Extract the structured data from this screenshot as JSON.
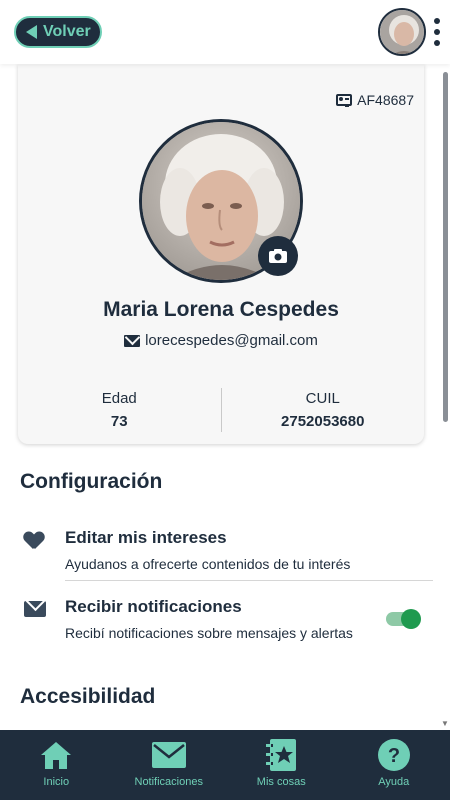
{
  "header": {
    "back_label": "Volver"
  },
  "profile": {
    "id_code": "AF48687",
    "name": "Maria Lorena Cespedes",
    "email": "lorecespedes@gmail.com",
    "stats": [
      {
        "label": "Edad",
        "value": "73"
      },
      {
        "label": "CUIL",
        "value": "2752053680"
      }
    ]
  },
  "config": {
    "title": "Configuración",
    "items": [
      {
        "title": "Editar mis intereses",
        "subtitle": "Ayudanos a ofrecerte contenidos de tu interés",
        "icon": "heart-icon"
      },
      {
        "title": "Recibir notificaciones",
        "subtitle": "Recibí notificaciones sobre mensajes y alertas",
        "icon": "envelope-icon",
        "toggle_on": true
      }
    ]
  },
  "accessibility": {
    "title": "Accesibilidad"
  },
  "bottom_nav": {
    "items": [
      {
        "label": "Inicio",
        "icon": "home-icon"
      },
      {
        "label": "Notificaciones",
        "icon": "mail-icon"
      },
      {
        "label": "Mis cosas",
        "icon": "star-notebook-icon"
      },
      {
        "label": "Ayuda",
        "icon": "help-icon"
      }
    ]
  },
  "colors": {
    "primary": "#1f2d3d",
    "accent": "#6fcfb6",
    "toggle": "#1f9a4f"
  }
}
